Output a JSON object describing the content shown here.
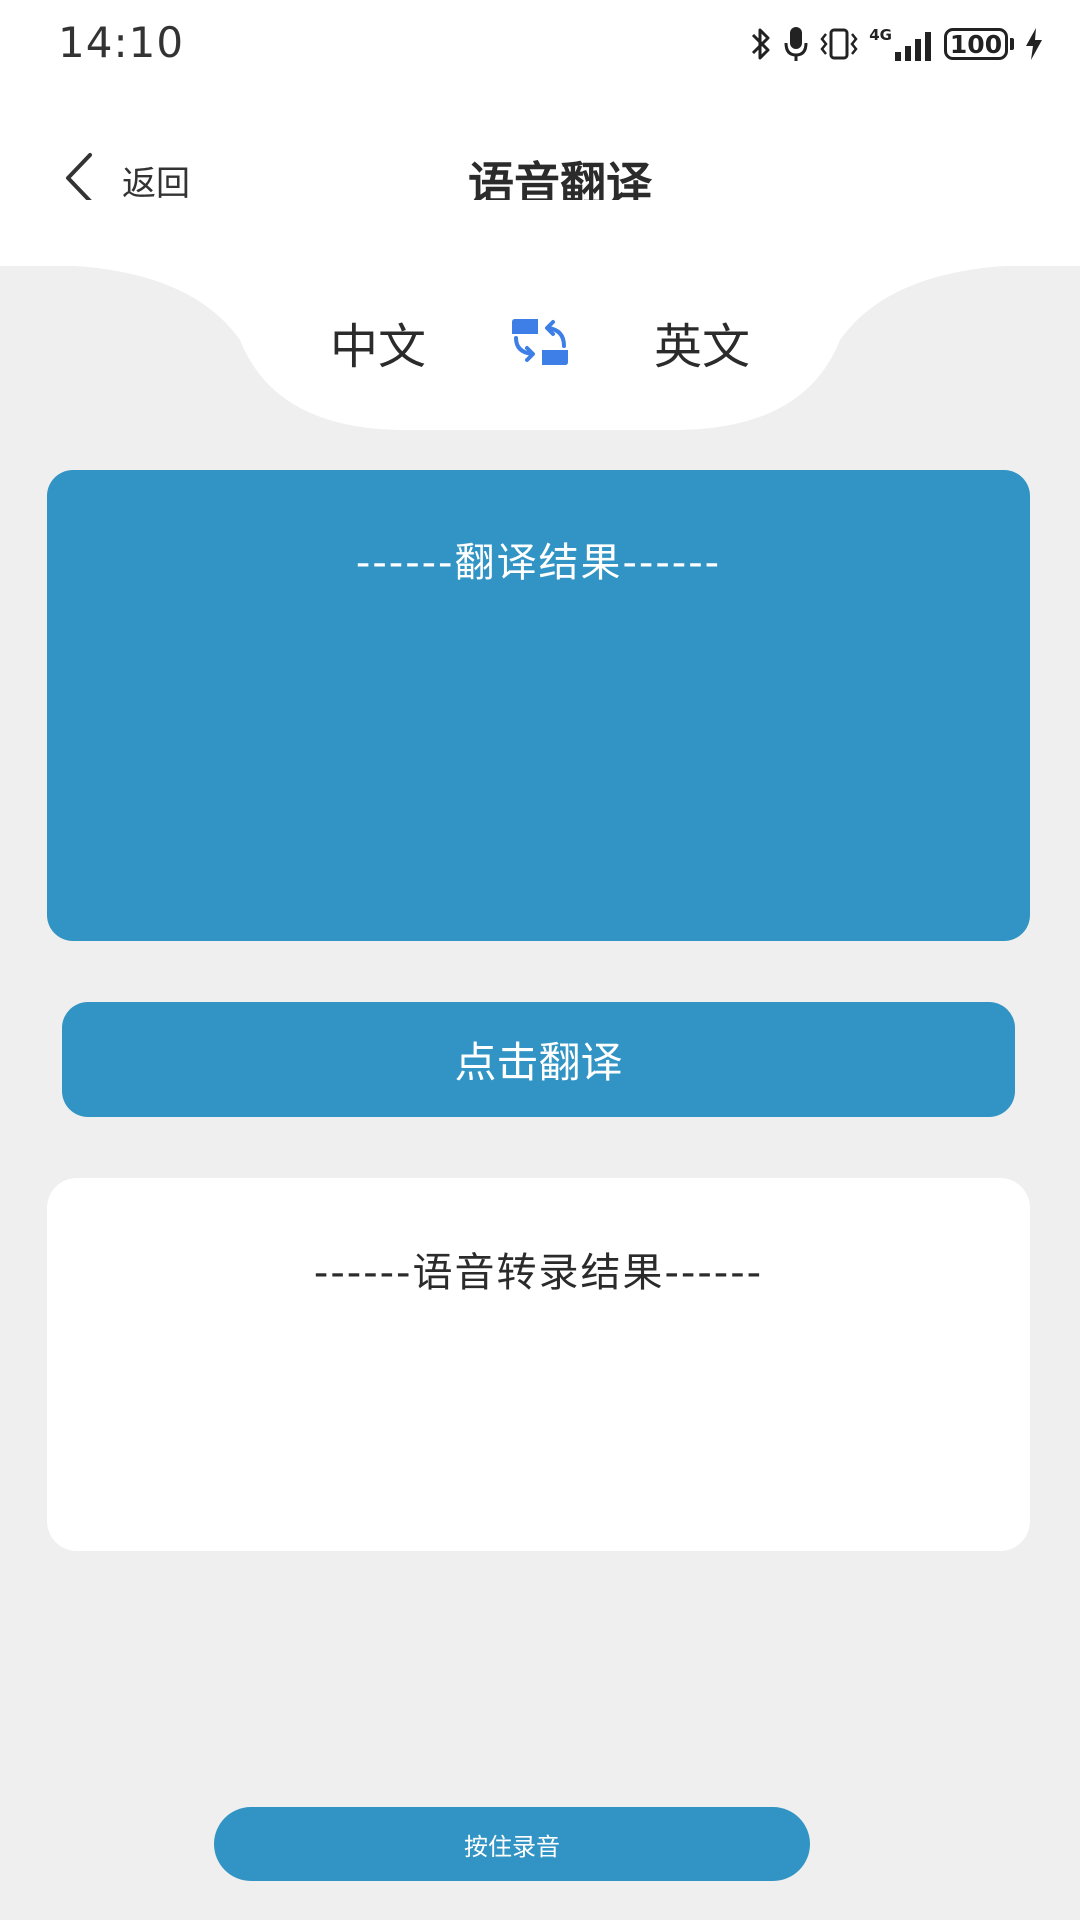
{
  "status_bar": {
    "time": "14:10",
    "battery": "100",
    "network": "4G"
  },
  "header": {
    "back_label": "返回",
    "title": "语音翻译"
  },
  "language_bar": {
    "source": "中文",
    "target": "英文"
  },
  "translation_card": {
    "title": "------翻译结果------",
    "text": ""
  },
  "translate_button": {
    "label": "点击翻译"
  },
  "transcript_card": {
    "title": "------语音转录结果------",
    "text": ""
  },
  "record_button": {
    "label": "按住录音"
  },
  "colors": {
    "accent": "#3194c4",
    "swap_icon": "#3d7fe6",
    "background": "#efefef",
    "surface": "#ffffff"
  },
  "icons": [
    "bluetooth-icon",
    "microphone-icon",
    "vibrate-icon",
    "signal-icon",
    "battery-icon",
    "charging-icon",
    "back-arrow-icon",
    "swap-languages-icon"
  ]
}
